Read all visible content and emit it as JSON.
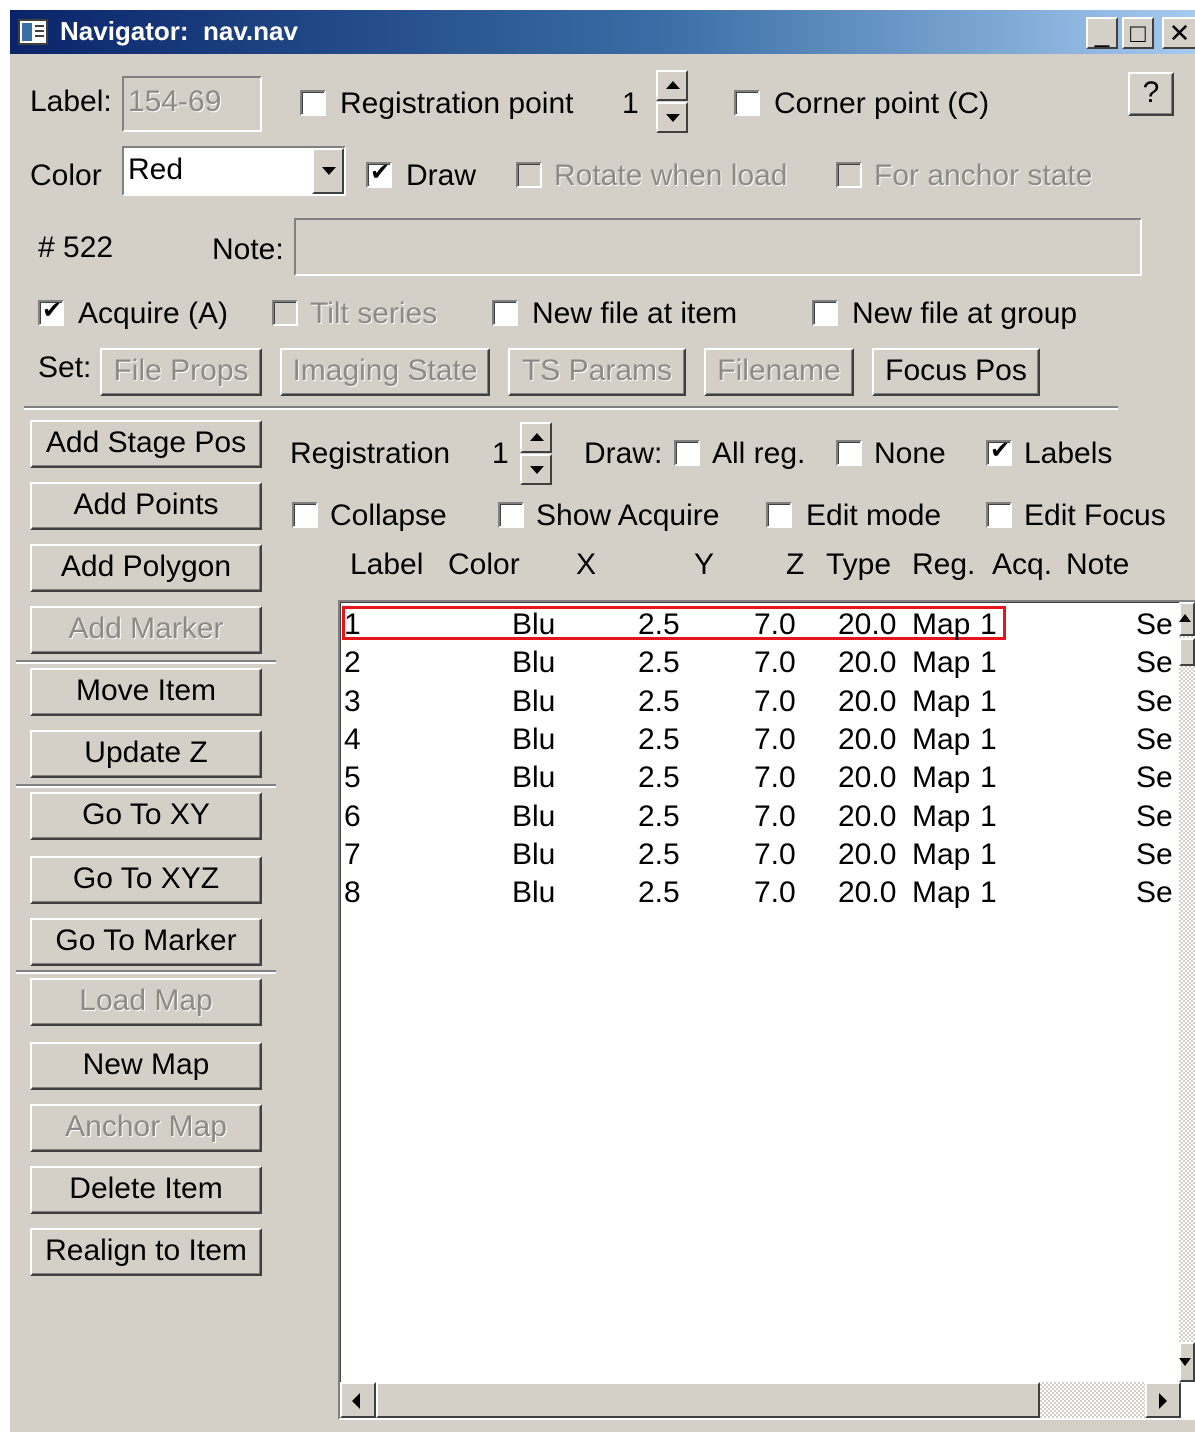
{
  "window": {
    "title": "Navigator:  nav.nav",
    "min_glyph": "_",
    "max_glyph": "□",
    "close_glyph": "✕"
  },
  "item": {
    "label_caption": "Label:",
    "label_value": "154-69",
    "registration_point_label": "Registration point",
    "registration_point_value": "1",
    "corner_point_label": "Corner point (C)",
    "help_label": "?",
    "color_caption": "Color",
    "color_value": "Red",
    "draw_label": "Draw",
    "draw_checked": true,
    "rotate_label": "Rotate when load",
    "anchor_state_label": "For anchor state",
    "number": "# 522",
    "note_caption": "Note:",
    "note_value": "",
    "acquire_label": "Acquire (A)",
    "acquire_checked": true,
    "tilt_series_label": "Tilt series",
    "new_file_item_label": "New file at item",
    "new_file_group_label": "New file at group",
    "set_caption": "Set:",
    "set_buttons": [
      "File Props",
      "Imaging State",
      "TS Params",
      "Filename",
      "Focus Pos"
    ]
  },
  "actions": [
    "Add Stage Pos",
    "Add Points",
    "Add Polygon",
    "Add Marker",
    "Move Item",
    "Update Z",
    "Go To XY",
    "Go To XYZ",
    "Go To Marker",
    "Load Map",
    "New Map",
    "Anchor Map",
    "Delete Item",
    "Realign to Item"
  ],
  "display": {
    "registration_label": "Registration",
    "registration_value": "1",
    "draw_caption": "Draw:",
    "all_reg_label": "All reg.",
    "none_label": "None",
    "labels_label": "Labels",
    "labels_checked": true,
    "collapse_label": "Collapse",
    "show_acquire_label": "Show Acquire",
    "edit_mode_label": "Edit mode",
    "edit_focus_label": "Edit Focus"
  },
  "table": {
    "columns": [
      "Label",
      "Color",
      "X",
      "Y",
      "Z",
      "Type",
      "Reg.",
      "Acq.",
      "Note"
    ],
    "rows": [
      [
        "1",
        "Blu",
        "2.5",
        "7.0",
        "20.0",
        "Map",
        "1",
        "",
        "Se"
      ],
      [
        "2",
        "Blu",
        "2.5",
        "7.0",
        "20.0",
        "Map",
        "1",
        "",
        "Se"
      ],
      [
        "3",
        "Blu",
        "2.5",
        "7.0",
        "20.0",
        "Map",
        "1",
        "",
        "Se"
      ],
      [
        "4",
        "Blu",
        "2.5",
        "7.0",
        "20.0",
        "Map",
        "1",
        "",
        "Se"
      ],
      [
        "5",
        "Blu",
        "2.5",
        "7.0",
        "20.0",
        "Map",
        "1",
        "",
        "Se"
      ],
      [
        "6",
        "Blu",
        "2.5",
        "7.0",
        "20.0",
        "Map",
        "1",
        "",
        "Se"
      ],
      [
        "7",
        "Blu",
        "2.5",
        "7.0",
        "20.0",
        "Map",
        "1",
        "",
        "Se"
      ],
      [
        "8",
        "Blu",
        "2.5",
        "7.0",
        "20.0",
        "Map",
        "1",
        "",
        "Se"
      ]
    ],
    "highlighted_row": 0,
    "highlight_color": "#e8141c"
  }
}
